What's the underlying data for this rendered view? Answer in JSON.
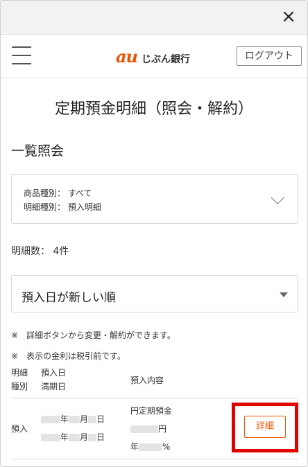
{
  "window": {
    "close_glyph": "×"
  },
  "header": {
    "logo_au": "au",
    "logo_text": "じぶん銀行",
    "logout_label": "ログアウト"
  },
  "page": {
    "title": "定期預金明細（照会・解約）",
    "section_title": "一覧照会"
  },
  "filter": {
    "product_type": "商品種別： すべて",
    "detail_type": "明細種別： 預入明細"
  },
  "count_label": "明細数： 4件",
  "sort": {
    "selected": "預入日が新しい順"
  },
  "notes": [
    "※　詳細ボタンから変更・解約ができます。",
    "※　表示の金利は税引前です。"
  ],
  "table": {
    "headers": {
      "type_line1": "明細",
      "type_line2": "種別",
      "date_line1": "預入日",
      "date_line2": "満期日",
      "content": "預入内容"
    },
    "rows": [
      {
        "type": "預入",
        "year_unit": "年",
        "month_unit": "月",
        "day_unit": "日",
        "content_title": "円定期預金",
        "amount_unit": "円",
        "rate_prefix": "年",
        "rate_unit": "%",
        "detail_label": "詳細"
      }
    ]
  },
  "colors": {
    "brand": "#ea5504",
    "highlight": "#e00000"
  }
}
